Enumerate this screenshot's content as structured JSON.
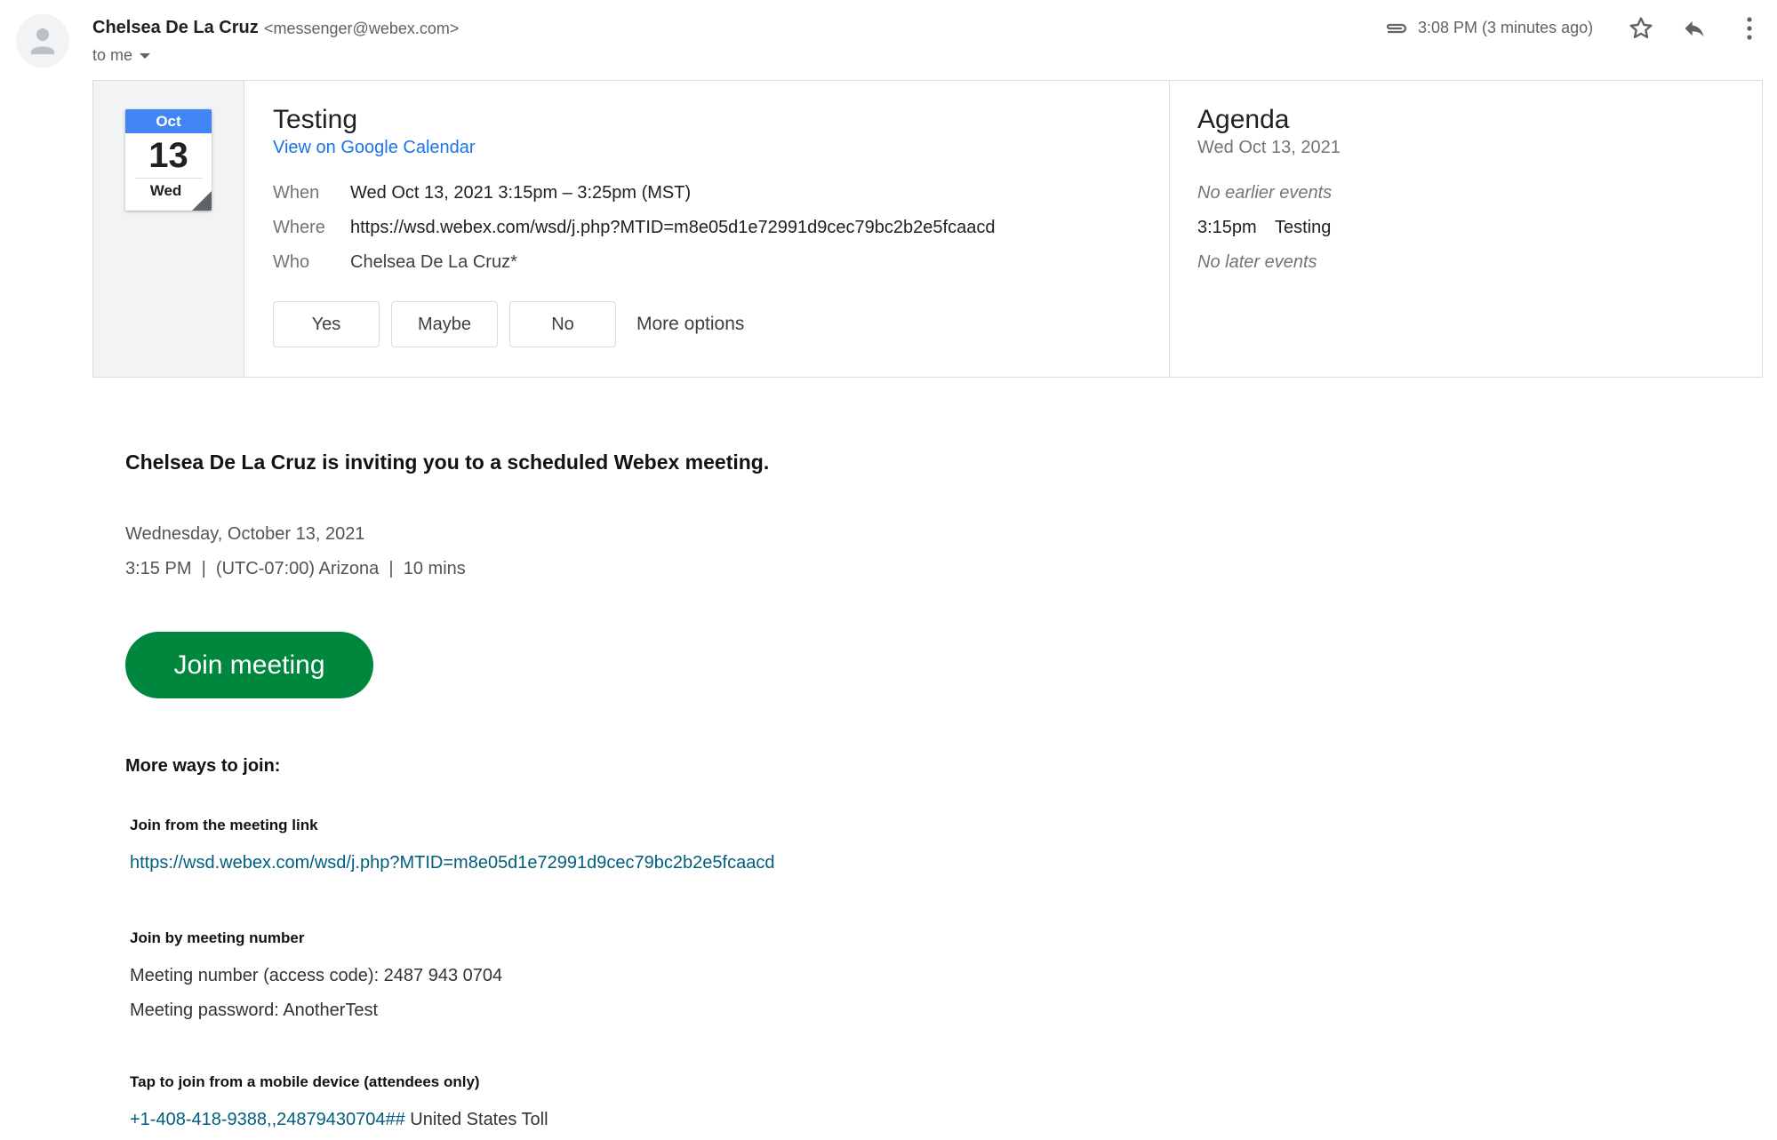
{
  "header": {
    "sender_name": "Chelsea De La Cruz",
    "sender_email": "<messenger@webex.com>",
    "to": "to me",
    "timestamp": "3:08 PM (3 minutes ago)",
    "icons": [
      "attachment-icon",
      "star-icon",
      "reply-icon",
      "more-vert-icon"
    ]
  },
  "calendar_card": {
    "month": "Oct",
    "day": "13",
    "weekday": "Wed",
    "title": "Testing",
    "gcal_link": "View on Google Calendar",
    "rows": [
      {
        "label": "When",
        "value": "Wed Oct 13, 2021 3:15pm – 3:25pm (MST)"
      },
      {
        "label": "Where",
        "value": "https://wsd.webex.com/wsd/j.php?MTID=m8e05d1e72991d9cec79bc2b2e5fcaacd"
      },
      {
        "label": "Who",
        "value": "Chelsea De La Cruz*"
      }
    ],
    "rsvp": {
      "yes": "Yes",
      "maybe": "Maybe",
      "no": "No",
      "more": "More options"
    },
    "agenda": {
      "title": "Agenda",
      "date": "Wed Oct 13, 2021",
      "no_earlier": "No earlier events",
      "event_time": "3:15pm",
      "event_title": "Testing",
      "no_later": "No later events"
    }
  },
  "invite": {
    "heading": "Chelsea De La Cruz is inviting you to a scheduled Webex meeting.",
    "date": "Wednesday, October 13, 2021",
    "time_line": "3:15 PM  |  (UTC-07:00) Arizona  |  10 mins",
    "join_button": "Join meeting",
    "more_ways": "More ways to join:",
    "link_heading": "Join from the meeting link",
    "meeting_link": "https://wsd.webex.com/wsd/j.php?MTID=m8e05d1e72991d9cec79bc2b2e5fcaacd",
    "number_heading": "Join by meeting number",
    "meeting_number": "Meeting number (access code): 2487 943 0704",
    "meeting_password": "Meeting password: AnotherTest",
    "mobile_heading": "Tap to join from a mobile device (attendees only)",
    "mobile_number": "+1-408-418-9388,,24879430704##",
    "mobile_label": "United States Toll"
  },
  "colors": {
    "join_button": "#00873e",
    "calendar_month": "#4285f4",
    "gcal_link": "#1a73e8",
    "webex_link": "#005e7d"
  }
}
